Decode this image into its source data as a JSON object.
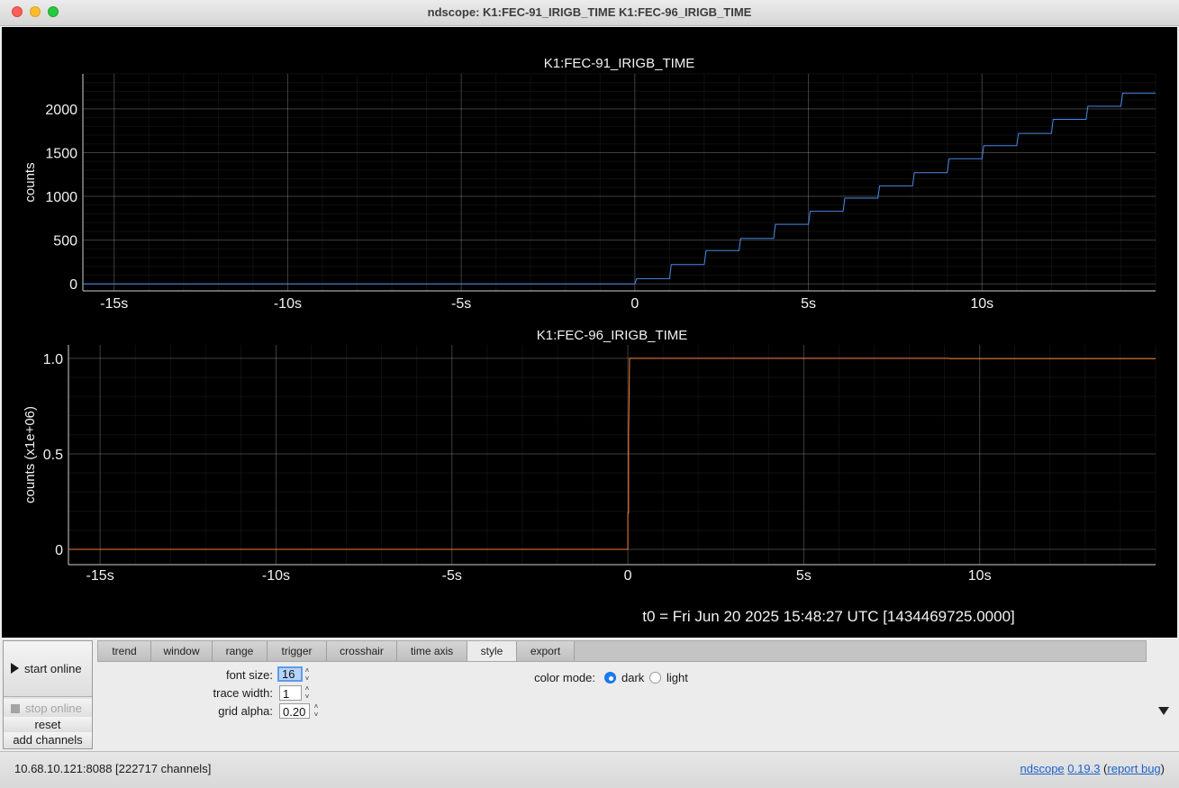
{
  "window": {
    "title": "ndscope: K1:FEC-91_IRIGB_TIME K1:FEC-96_IRIGB_TIME"
  },
  "colors": {
    "trace1": "#4a88e8",
    "trace2": "#f07b35",
    "background": "#000000",
    "axis": "#dddddd"
  },
  "chart_data": [
    {
      "type": "line",
      "title": "K1:FEC-91_IRIGB_TIME",
      "ylabel": "counts",
      "xlim": [
        -15.9,
        15
      ],
      "ylim": [
        -80,
        2400
      ],
      "x_ticks": [
        -15,
        -10,
        -5,
        0,
        5,
        10
      ],
      "x_tick_labels": [
        "-15s",
        "-10s",
        "-5s",
        "0",
        "5s",
        "10s"
      ],
      "y_ticks": [
        0,
        500,
        1000,
        1500,
        2000
      ],
      "y_tick_labels": [
        "0",
        "500",
        "1000",
        "1500",
        "2000"
      ],
      "grid": true,
      "series": [
        {
          "color": "#4a88e8",
          "x": [
            -15.9,
            0,
            0.05,
            1,
            1.05,
            2,
            2.05,
            3,
            3.05,
            4,
            4.05,
            5,
            5.05,
            6,
            6.05,
            7,
            7.05,
            8,
            8.05,
            9,
            9.05,
            10,
            10.05,
            11,
            11.05,
            12,
            12.05,
            13,
            13.05,
            14,
            14.05,
            15
          ],
          "y": [
            0,
            0,
            60,
            60,
            220,
            220,
            380,
            380,
            520,
            520,
            680,
            680,
            830,
            830,
            980,
            980,
            1120,
            1120,
            1270,
            1270,
            1430,
            1430,
            1580,
            1580,
            1720,
            1720,
            1880,
            1880,
            2030,
            2030,
            2180,
            2180
          ]
        }
      ]
    },
    {
      "type": "line",
      "title": "K1:FEC-96_IRIGB_TIME",
      "ylabel": "counts (x1e+06)",
      "xlim": [
        -15.9,
        15
      ],
      "ylim": [
        -0.08,
        1.07
      ],
      "x_ticks": [
        -15,
        -10,
        -5,
        0,
        5,
        10
      ],
      "x_tick_labels": [
        "-15s",
        "-10s",
        "-5s",
        "0",
        "5s",
        "10s"
      ],
      "y_ticks": [
        0,
        0.5,
        1.0
      ],
      "y_tick_labels": [
        "0",
        "0.5",
        "1.0"
      ],
      "grid": true,
      "series": [
        {
          "color": "#f07b35",
          "x": [
            -15.9,
            0,
            0,
            0.02,
            0.02,
            0.05,
            9.1,
            9.15,
            15
          ],
          "y": [
            0,
            0,
            0.19,
            0.19,
            0.6,
            1.0,
            1.0,
            0.998,
            0.998
          ]
        }
      ]
    }
  ],
  "t0_label": "t0 = Fri Jun 20 2025 15:48:27 UTC [1434469725.0000]",
  "buttons": {
    "start_online": "start online",
    "stop_online": "stop online",
    "reset": "reset",
    "add_channels": "add channels"
  },
  "tabs": [
    "trend",
    "window",
    "range",
    "trigger",
    "crosshair",
    "time axis",
    "style",
    "export"
  ],
  "active_tab": "style",
  "style_panel": {
    "font_size_label": "font size:",
    "font_size": "16",
    "trace_width_label": "trace width:",
    "trace_width": "1",
    "grid_alpha_label": "grid alpha:",
    "grid_alpha": "0.20",
    "color_mode_label": "color mode:",
    "dark_label": "dark",
    "light_label": "light",
    "color_mode": "dark"
  },
  "status": {
    "server": "10.68.10.121:8088  [222717 channels]",
    "app_link": "ndscope",
    "version_link": "0.19.3",
    "open_paren": " (",
    "report_link": "report bug",
    "close_paren": ")"
  }
}
